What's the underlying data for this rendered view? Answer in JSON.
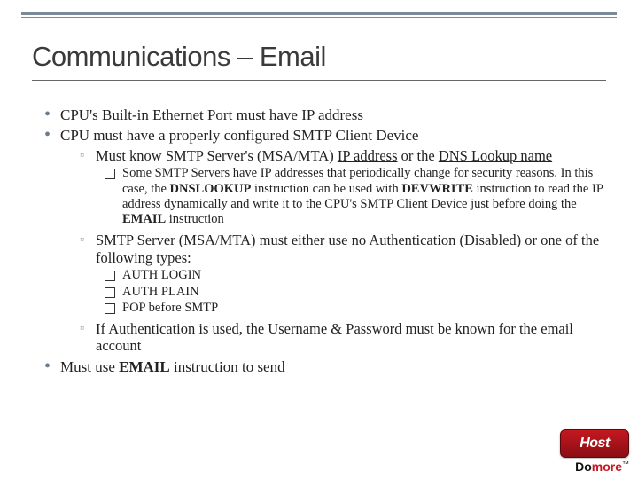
{
  "title": "Communications – Email",
  "bullets": {
    "b1": "CPU's Built-in Ethernet Port must have IP address",
    "b2": "CPU must have a properly configured SMTP Client Device",
    "sub1_pre": "Must know SMTP Server's (MSA/MTA) ",
    "sub1_u1": "IP address",
    "sub1_mid": " or the ",
    "sub1_u2": "DNS Lookup name",
    "note1_a": "Some SMTP Servers have IP addresses that periodically change for security reasons. In this case, the ",
    "note1_b": "DNSLOOKUP",
    "note1_c": " instruction can be used with ",
    "note1_d": "DEVWRITE",
    "note1_e": " instruction to read the IP address dynamically and write it to the CPU's SMTP Client Device just before doing the ",
    "note1_f": "EMAIL",
    "note1_g": " instruction",
    "sub2": "SMTP Server (MSA/MTA) must either use no Authentication (Disabled) or one of the following types:",
    "auth1": "AUTH LOGIN",
    "auth2": "AUTH PLAIN",
    "auth3": "POP before SMTP",
    "sub3": "If Authentication is used, the Username & Password must be known for the email account",
    "b3_a": "Must use ",
    "b3_b": "EMAIL",
    "b3_c": " instruction to send"
  },
  "logo": {
    "host": "Host",
    "domore_d": "Do",
    "domore_m": "more",
    "tm": "™"
  }
}
